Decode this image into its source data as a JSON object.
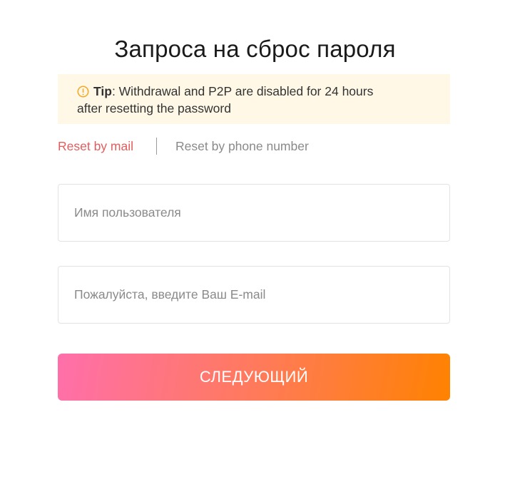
{
  "page": {
    "title": "Запроса на сброс пароля"
  },
  "tip": {
    "icon": "warning-circle-icon",
    "label": "Tip",
    "text_line1": ": Withdrawal and P2P are disabled for 24 hours",
    "text_line2": "after resetting the password"
  },
  "tabs": [
    {
      "label": "Reset by mail",
      "active": true
    },
    {
      "label": "Reset by phone number",
      "active": false
    }
  ],
  "form": {
    "username": {
      "value": "",
      "placeholder": "Имя пользователя"
    },
    "email": {
      "value": "",
      "placeholder": "Пожалуйста, введите Ваш E-mail"
    }
  },
  "actions": {
    "next_label": "СЛЕДУЮЩИЙ"
  },
  "colors": {
    "tip_background": "#fff8e6",
    "tip_icon": "#f5a623",
    "active_tab": "#e35d5d",
    "inactive_tab": "#8a8a8a",
    "button_gradient_start": "#ff6fab",
    "button_gradient_end": "#ff8200"
  }
}
